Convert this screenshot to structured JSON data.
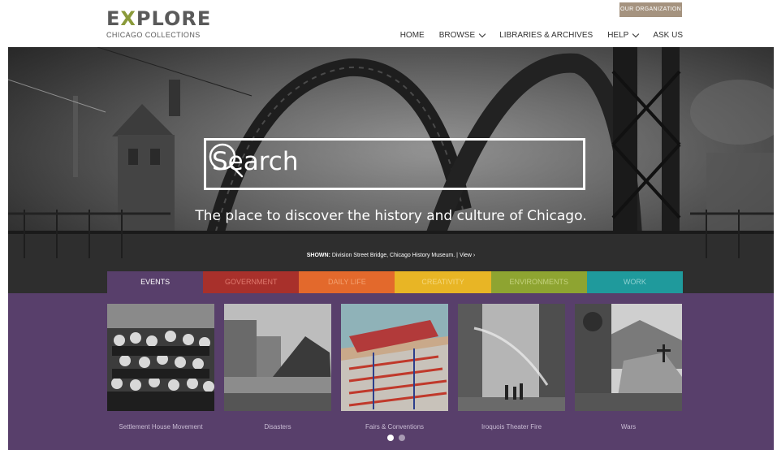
{
  "header": {
    "logo_main": "EXPLORE",
    "logo_sub": "CHICAGO COLLECTIONS",
    "org_button": "OUR ORGANIZATION",
    "nav": [
      {
        "label": "HOME",
        "has_dropdown": false
      },
      {
        "label": "BROWSE",
        "has_dropdown": true
      },
      {
        "label": "LIBRARIES & ARCHIVES",
        "has_dropdown": false
      },
      {
        "label": "HELP",
        "has_dropdown": true
      },
      {
        "label": "ASK US",
        "has_dropdown": false
      }
    ]
  },
  "hero": {
    "search_placeholder": "Search",
    "search_icon": "search-icon",
    "tagline": "The place to discover the history and culture of Chicago.",
    "caption_prefix": "SHOWN:",
    "caption_text": "Division Street Bridge, Chicago History Museum.",
    "caption_sep": "|",
    "caption_link": "View ›"
  },
  "tabs": [
    {
      "label": "EVENTS",
      "color": "#583f6b",
      "text_color": "#ffffff",
      "active": true
    },
    {
      "label": "GOVERNMENT",
      "color": "#a8302b",
      "text_color": "#e07a6f",
      "active": false
    },
    {
      "label": "DAILY LIFE",
      "color": "#e3692c",
      "text_color": "#f3a170",
      "active": false
    },
    {
      "label": "CREATIVITY",
      "color": "#e8b525",
      "text_color": "#f5d77a",
      "active": false
    },
    {
      "label": "ENVIRONMENTS",
      "color": "#8ea431",
      "text_color": "#c4d27e",
      "active": false
    },
    {
      "label": "WORK",
      "color": "#1f9a9c",
      "text_color": "#8fd1d1",
      "active": false
    }
  ],
  "cards": [
    {
      "label": "Settlement House Movement"
    },
    {
      "label": "Disasters"
    },
    {
      "label": "Fairs & Conventions"
    },
    {
      "label": "Iroquois Theater Fire"
    },
    {
      "label": "Wars"
    }
  ],
  "carousel": {
    "pages": 2,
    "current": 1
  },
  "colors": {
    "panel": "#583f6b",
    "org_button": "#a5937f"
  }
}
